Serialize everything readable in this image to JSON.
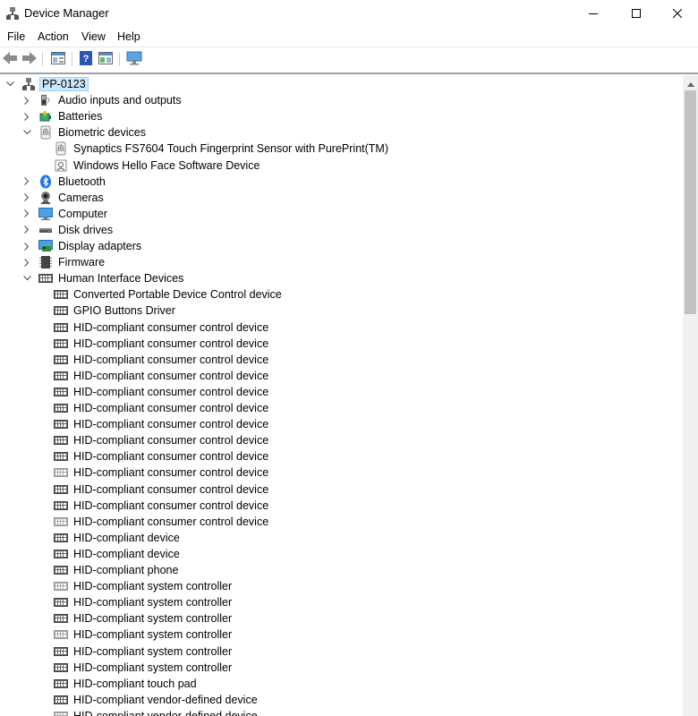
{
  "window": {
    "title": "Device Manager",
    "controls": [
      "minimize",
      "maximize",
      "close"
    ]
  },
  "menu": [
    "File",
    "Action",
    "View",
    "Help"
  ],
  "toolbar": [
    "back",
    "forward",
    "properties",
    "help",
    "show-hidden",
    "scan-hardware"
  ],
  "tree": {
    "root": "PP-0123",
    "categories": [
      {
        "label": "Audio inputs and outputs",
        "icon": "speaker-icon",
        "expanded": false
      },
      {
        "label": "Batteries",
        "icon": "battery-icon",
        "expanded": false
      },
      {
        "label": "Biometric devices",
        "icon": "fingerprint-icon",
        "expanded": true,
        "children": [
          {
            "label": "Synaptics FS7604 Touch Fingerprint Sensor with PurePrint(TM)",
            "icon": "fingerprint-icon"
          },
          {
            "label": "Windows Hello Face Software Device",
            "icon": "face-device-icon"
          }
        ]
      },
      {
        "label": "Bluetooth",
        "icon": "bluetooth-icon",
        "expanded": false
      },
      {
        "label": "Cameras",
        "icon": "camera-icon",
        "expanded": false
      },
      {
        "label": "Computer",
        "icon": "computer-icon",
        "expanded": false
      },
      {
        "label": "Disk drives",
        "icon": "disk-icon",
        "expanded": false
      },
      {
        "label": "Display adapters",
        "icon": "display-adapter-icon",
        "expanded": false
      },
      {
        "label": "Firmware",
        "icon": "firmware-icon",
        "expanded": false
      },
      {
        "label": "Human Interface Devices",
        "icon": "hid-icon",
        "expanded": true,
        "children": [
          {
            "label": "Converted Portable Device Control device",
            "icon": "hid-icon"
          },
          {
            "label": "GPIO Buttons Driver",
            "icon": "hid-icon"
          },
          {
            "label": "HID-compliant consumer control device",
            "icon": "hid-icon"
          },
          {
            "label": "HID-compliant consumer control device",
            "icon": "hid-icon"
          },
          {
            "label": "HID-compliant consumer control device",
            "icon": "hid-icon"
          },
          {
            "label": "HID-compliant consumer control device",
            "icon": "hid-icon"
          },
          {
            "label": "HID-compliant consumer control device",
            "icon": "hid-icon"
          },
          {
            "label": "HID-compliant consumer control device",
            "icon": "hid-icon"
          },
          {
            "label": "HID-compliant consumer control device",
            "icon": "hid-icon"
          },
          {
            "label": "HID-compliant consumer control device",
            "icon": "hid-icon"
          },
          {
            "label": "HID-compliant consumer control device",
            "icon": "hid-icon"
          },
          {
            "label": "HID-compliant consumer control device",
            "icon": "hid-disabled-icon"
          },
          {
            "label": "HID-compliant consumer control device",
            "icon": "hid-icon"
          },
          {
            "label": "HID-compliant consumer control device",
            "icon": "hid-icon"
          },
          {
            "label": "HID-compliant consumer control device",
            "icon": "hid-disabled-icon"
          },
          {
            "label": "HID-compliant device",
            "icon": "hid-icon"
          },
          {
            "label": "HID-compliant device",
            "icon": "hid-icon"
          },
          {
            "label": "HID-compliant phone",
            "icon": "hid-icon"
          },
          {
            "label": "HID-compliant system controller",
            "icon": "hid-disabled-icon"
          },
          {
            "label": "HID-compliant system controller",
            "icon": "hid-icon"
          },
          {
            "label": "HID-compliant system controller",
            "icon": "hid-icon"
          },
          {
            "label": "HID-compliant system controller",
            "icon": "hid-disabled-icon"
          },
          {
            "label": "HID-compliant system controller",
            "icon": "hid-icon"
          },
          {
            "label": "HID-compliant system controller",
            "icon": "hid-icon"
          },
          {
            "label": "HID-compliant touch pad",
            "icon": "hid-icon"
          },
          {
            "label": "HID-compliant vendor-defined device",
            "icon": "hid-icon"
          },
          {
            "label": "HID-compliant vendor-defined device",
            "icon": "hid-disabled-icon"
          }
        ]
      }
    ]
  }
}
